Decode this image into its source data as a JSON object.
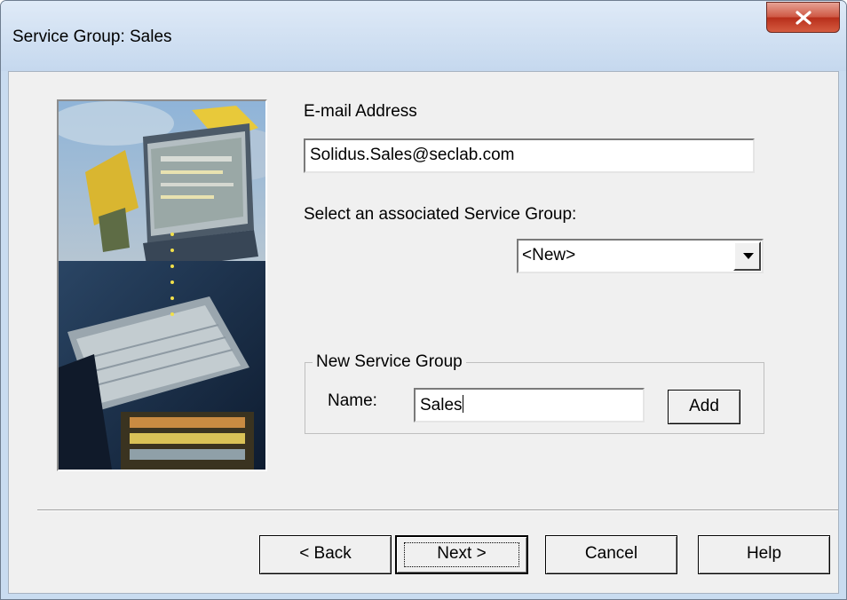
{
  "window": {
    "title": "Service Group: Sales",
    "close_icon": "close-icon"
  },
  "form": {
    "email_label": "E-mail Address",
    "email_value": "Solidus.Sales@seclab.com",
    "service_group_label": "Select an associated Service Group:",
    "service_group_selected": "<New>",
    "new_group": {
      "title": "New Service Group",
      "name_label": "Name:",
      "name_value": "Sales",
      "add_label": "Add"
    }
  },
  "buttons": {
    "back": "< Back",
    "next": "Next >",
    "cancel": "Cancel",
    "help": "Help"
  },
  "colors": {
    "close_button": "#c8412b",
    "title_bar": "#c5d8ee",
    "dialog_face": "#f0f0f0"
  }
}
